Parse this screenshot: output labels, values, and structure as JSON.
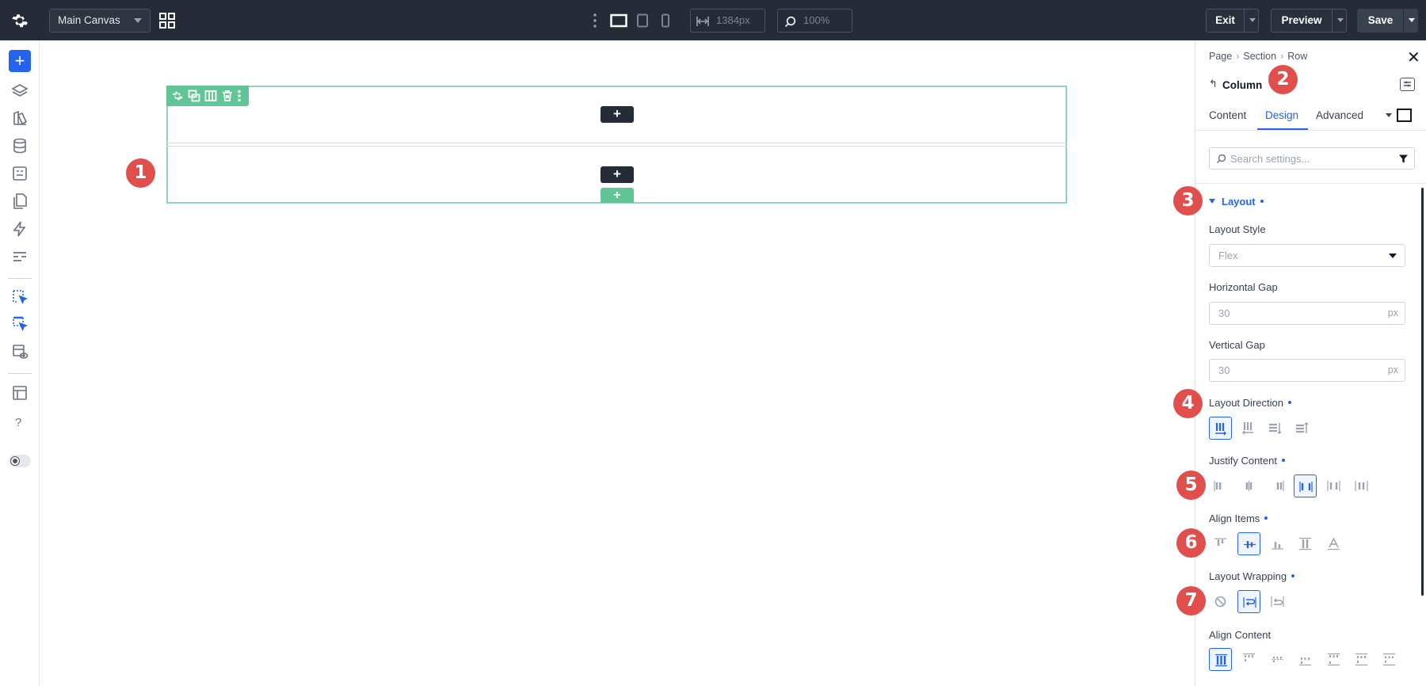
{
  "topbar": {
    "canvas_name": "Main Canvas",
    "width_value": "1384px",
    "zoom_value": "100%",
    "exit_label": "Exit",
    "preview_label": "Preview",
    "save_label": "Save"
  },
  "canvas": {
    "markers": [
      "1"
    ]
  },
  "panel": {
    "breadcrumb": [
      "Page",
      "Section",
      "Row"
    ],
    "element_title": "Column",
    "tabs": [
      "Content",
      "Design",
      "Advanced"
    ],
    "active_tab": "Design",
    "search_placeholder": "Search settings...",
    "section_title": "Layout",
    "layout_style_label": "Layout Style",
    "layout_style_value": "Flex",
    "horizontal_gap_label": "Horizontal Gap",
    "horizontal_gap_value": "30",
    "vertical_gap_label": "Vertical Gap",
    "vertical_gap_value": "30",
    "unit": "px",
    "layout_direction_label": "Layout Direction",
    "justify_content_label": "Justify Content",
    "align_items_label": "Align Items",
    "layout_wrapping_label": "Layout Wrapping",
    "align_content_label": "Align Content",
    "markers": [
      "2",
      "3",
      "4",
      "5",
      "6",
      "7"
    ]
  },
  "colors": {
    "accent": "#2563eb",
    "topbar": "#262c37",
    "column_outline": "#62c595",
    "marker": "#e04f4b"
  }
}
